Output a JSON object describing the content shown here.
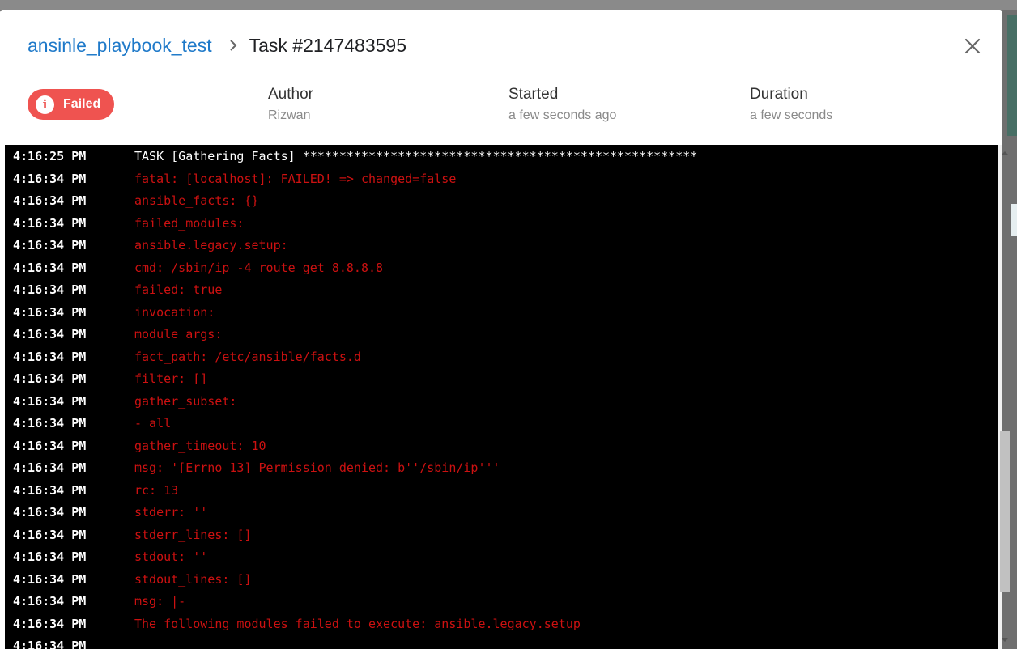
{
  "breadcrumb": {
    "project": "ansinle_playbook_test",
    "task": "Task #2147483595"
  },
  "status": {
    "label": "Failed",
    "color": "#ef5350",
    "icon": "info-icon"
  },
  "meta": {
    "author_label": "Author",
    "author_value": "Rizwan",
    "started_label": "Started",
    "started_value": "a few seconds ago",
    "duration_label": "Duration",
    "duration_value": "a few seconds"
  },
  "log": [
    {
      "time": "4:16:25 PM",
      "msg": "TASK [Gathering Facts] ******************************************************",
      "color": "white"
    },
    {
      "time": "4:16:34 PM",
      "msg": "fatal: [localhost]: FAILED! => changed=false",
      "color": "red"
    },
    {
      "time": "4:16:34 PM",
      "msg": "ansible_facts: {}",
      "color": "red"
    },
    {
      "time": "4:16:34 PM",
      "msg": "failed_modules:",
      "color": "red"
    },
    {
      "time": "4:16:34 PM",
      "msg": "ansible.legacy.setup:",
      "color": "red"
    },
    {
      "time": "4:16:34 PM",
      "msg": "cmd: /sbin/ip -4 route get 8.8.8.8",
      "color": "red"
    },
    {
      "time": "4:16:34 PM",
      "msg": "failed: true",
      "color": "red"
    },
    {
      "time": "4:16:34 PM",
      "msg": "invocation:",
      "color": "red"
    },
    {
      "time": "4:16:34 PM",
      "msg": "module_args:",
      "color": "red"
    },
    {
      "time": "4:16:34 PM",
      "msg": "fact_path: /etc/ansible/facts.d",
      "color": "red"
    },
    {
      "time": "4:16:34 PM",
      "msg": "filter: []",
      "color": "red"
    },
    {
      "time": "4:16:34 PM",
      "msg": "gather_subset:",
      "color": "red"
    },
    {
      "time": "4:16:34 PM",
      "msg": "- all",
      "color": "red"
    },
    {
      "time": "4:16:34 PM",
      "msg": "gather_timeout: 10",
      "color": "red"
    },
    {
      "time": "4:16:34 PM",
      "msg": "msg: '[Errno 13] Permission denied: b''/sbin/ip'''",
      "color": "red"
    },
    {
      "time": "4:16:34 PM",
      "msg": "rc: 13",
      "color": "red"
    },
    {
      "time": "4:16:34 PM",
      "msg": "stderr: ''",
      "color": "red"
    },
    {
      "time": "4:16:34 PM",
      "msg": "stderr_lines: []",
      "color": "red"
    },
    {
      "time": "4:16:34 PM",
      "msg": "stdout: ''",
      "color": "red"
    },
    {
      "time": "4:16:34 PM",
      "msg": "stdout_lines: []",
      "color": "red"
    },
    {
      "time": "4:16:34 PM",
      "msg": "msg: |-",
      "color": "red"
    },
    {
      "time": "4:16:34 PM",
      "msg": "The following modules failed to execute: ansible.legacy.setup",
      "color": "red"
    },
    {
      "time": "4:16:34 PM",
      "msg": "",
      "color": "red"
    }
  ]
}
